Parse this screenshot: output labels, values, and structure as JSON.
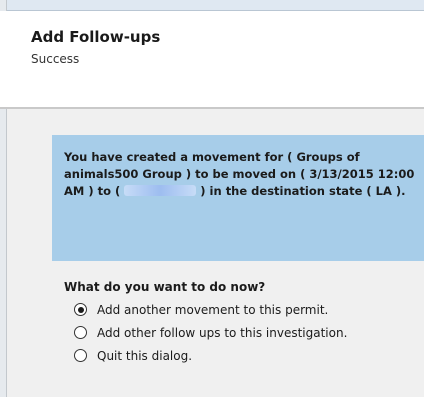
{
  "dialog": {
    "title": "Add Follow-ups",
    "subtitle": "Success"
  },
  "message": {
    "part1": "You have created a movement for ( Groups of animals500  Group ) to be moved on ( 3/13/2015 12:00 AM ) to (",
    "part2": ") in the destination state ( LA )."
  },
  "question": "What do you want to do now?",
  "options": [
    {
      "label": "Add another movement to this permit.",
      "selected": true
    },
    {
      "label": "Add other follow ups to this investigation.",
      "selected": false
    },
    {
      "label": "Quit this dialog.",
      "selected": false
    }
  ],
  "colors": {
    "info_box": "#a7cde9",
    "body_background": "#f0f0f0"
  }
}
